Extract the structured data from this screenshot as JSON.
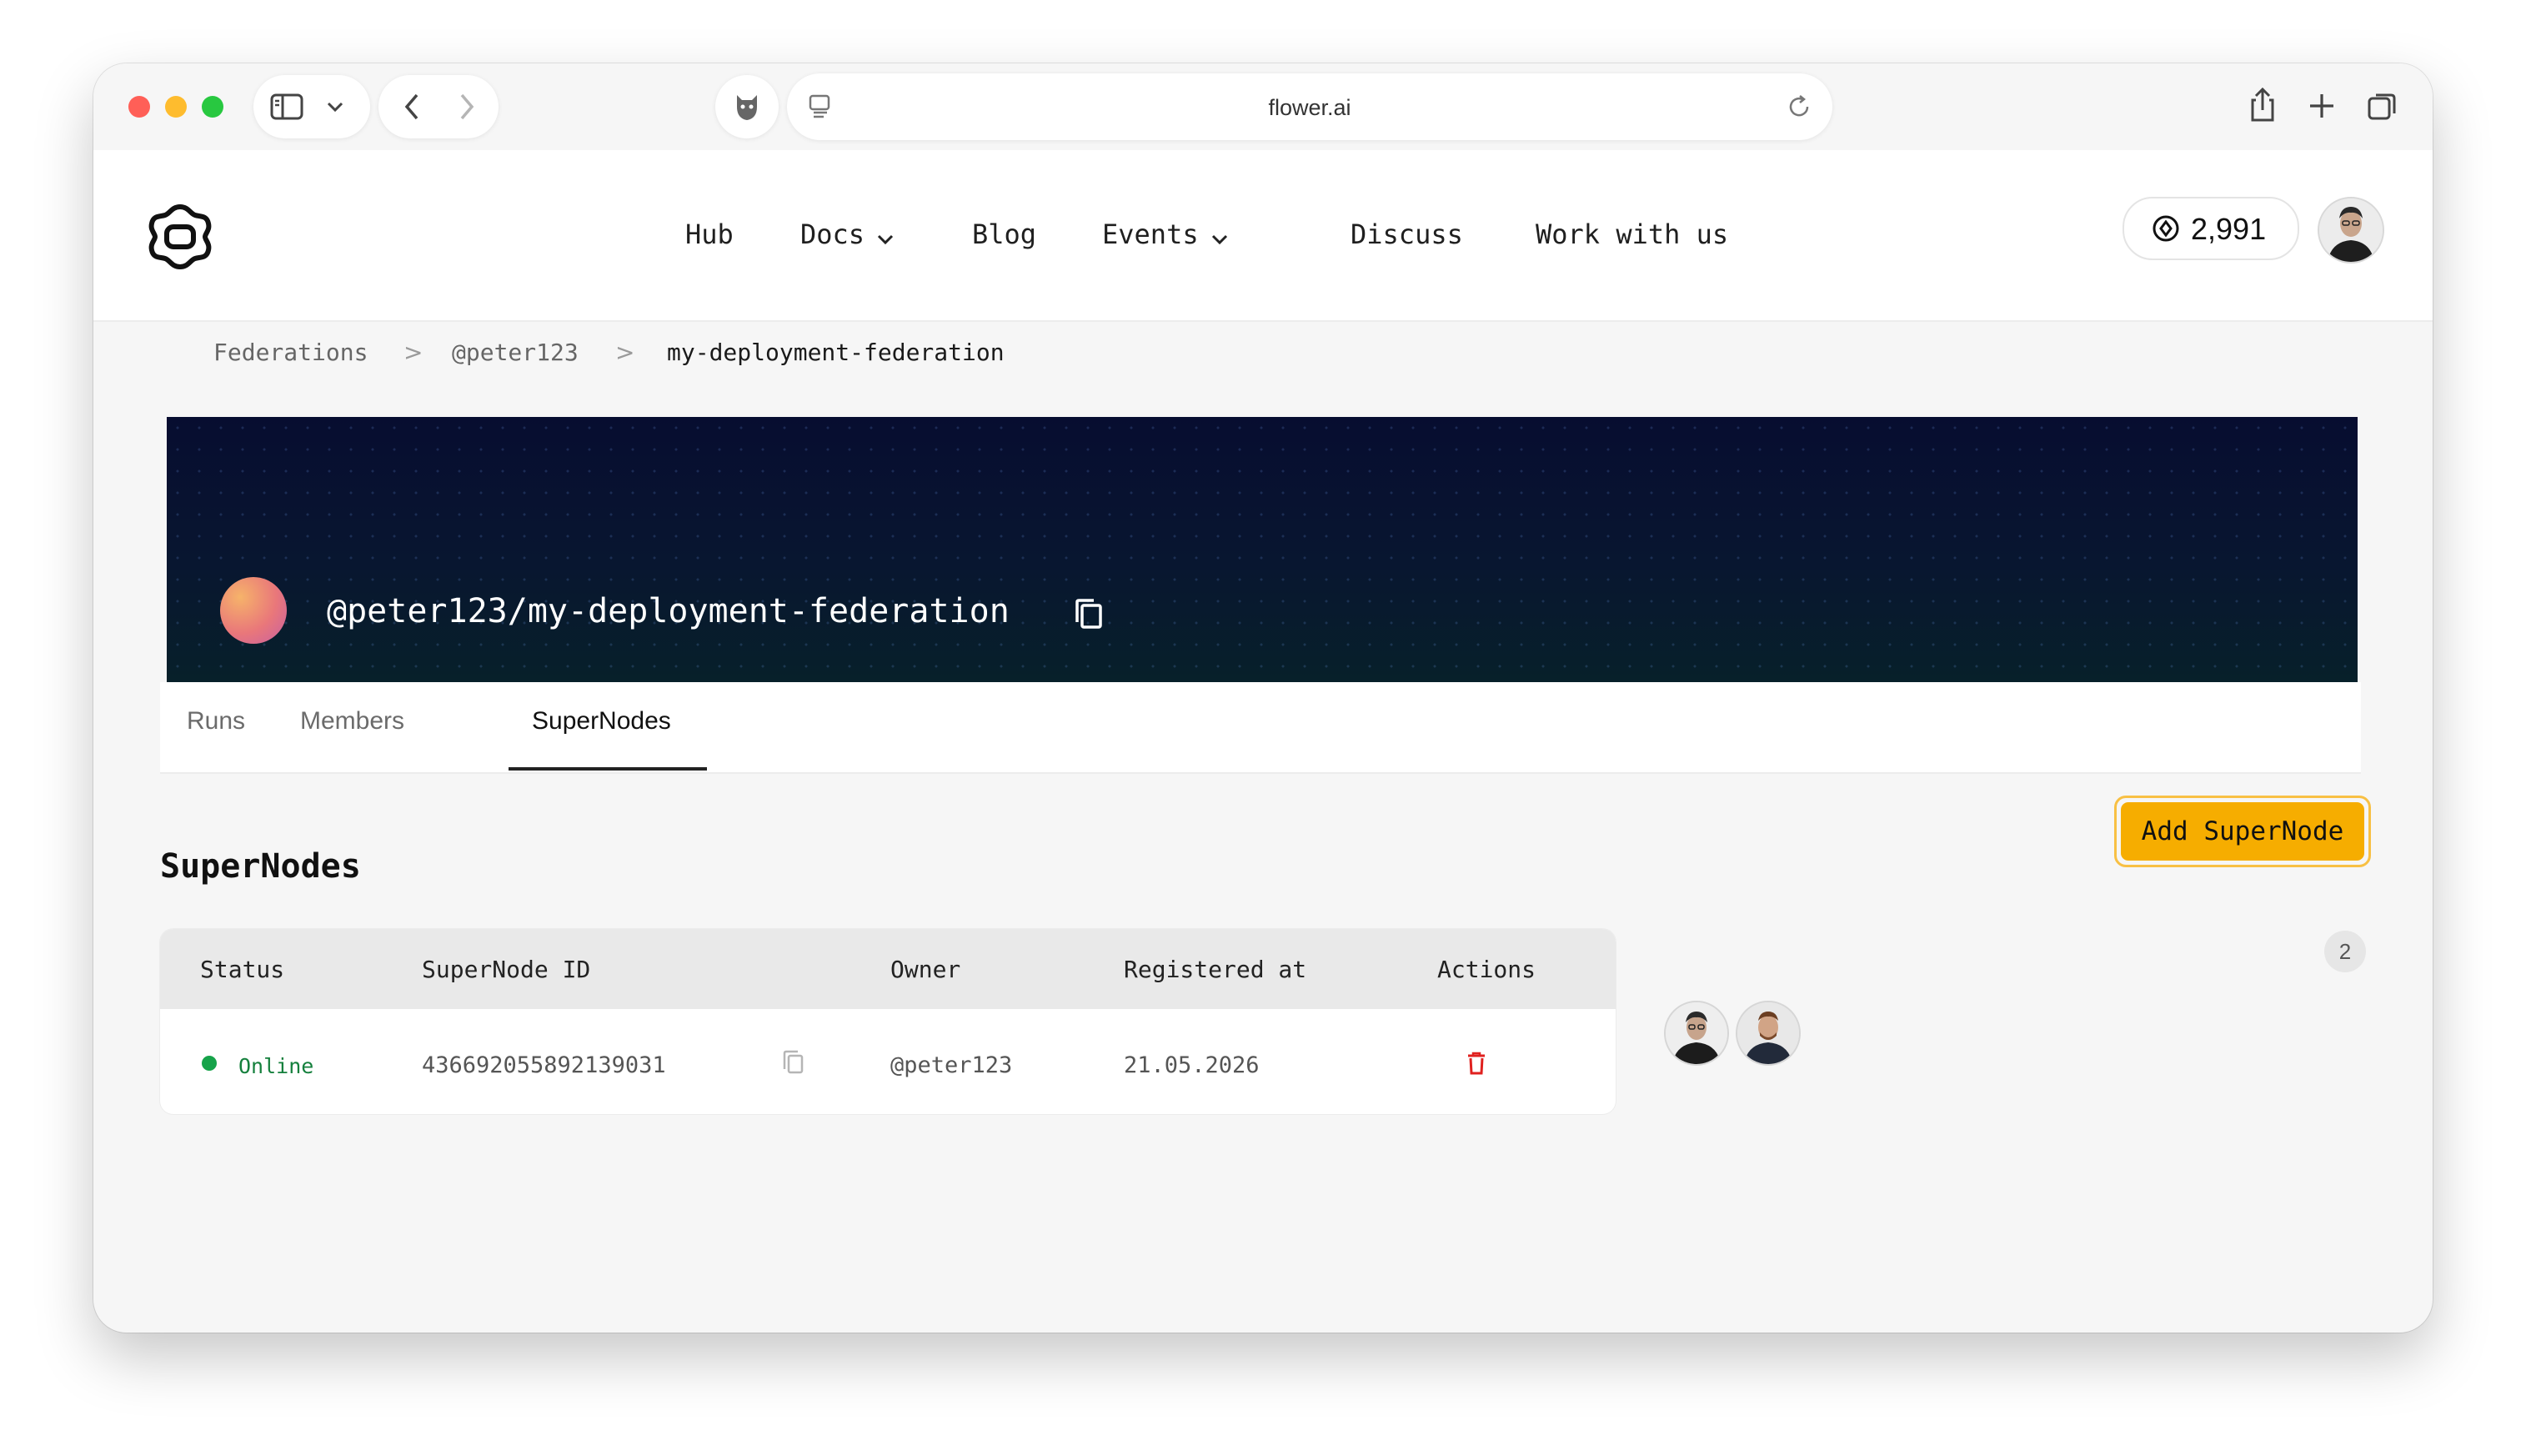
{
  "browser": {
    "url": "flower.ai",
    "traffic_lights": {
      "close": "#ff5f57",
      "minimize": "#febc2e",
      "zoom": "#28c840"
    }
  },
  "nav": {
    "items": [
      {
        "label": "Hub"
      },
      {
        "label": "Docs",
        "has_dropdown": true
      },
      {
        "label": "Blog"
      },
      {
        "label": "Events",
        "has_dropdown": true
      },
      {
        "label": "Discuss"
      },
      {
        "label": "Work with us"
      }
    ],
    "credits": "2,991"
  },
  "breadcrumb": {
    "items": [
      "Federations",
      "@peter123",
      "my-deployment-federation"
    ],
    "separator": ">"
  },
  "federation": {
    "title": "@peter123/my-deployment-federation"
  },
  "tabs": [
    {
      "label": "Runs",
      "active": false
    },
    {
      "label": "Members",
      "active": false
    },
    {
      "label": "SuperNodes",
      "active": true
    }
  ],
  "supernodes": {
    "section_title": "SuperNodes",
    "add_button": "Add SuperNode",
    "columns": [
      "Status",
      "SuperNode ID",
      "Owner",
      "Registered at",
      "Actions"
    ],
    "rows": [
      {
        "status": "Online",
        "id": "436692055892139031",
        "owner": "@peter123",
        "registered_at": "21.05.2026"
      }
    ],
    "status_color": "#16a34a",
    "delete_color": "#e0211f"
  },
  "members": {
    "count": "2"
  },
  "colors": {
    "accent": "#f6ad00",
    "banner": "#081630"
  }
}
